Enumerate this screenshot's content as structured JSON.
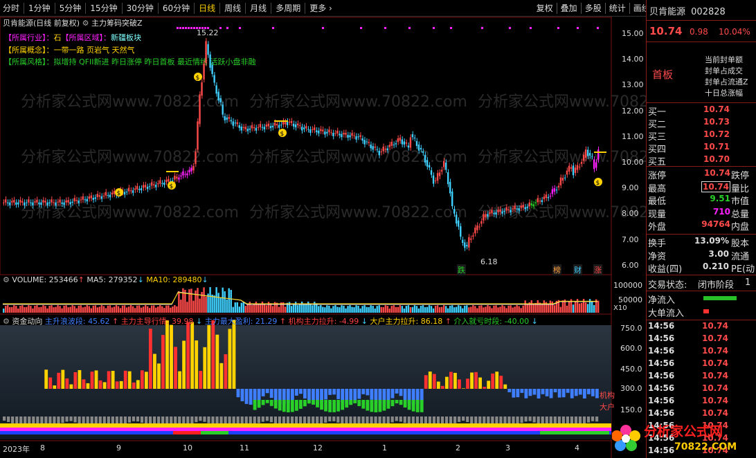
{
  "toolbar": {
    "periods": [
      "分时",
      "1分钟",
      "5分钟",
      "15分钟",
      "30分钟",
      "60分钟",
      "日线",
      "周线",
      "月线",
      "多周期",
      "更多"
    ],
    "active_period": "日线",
    "buttons": [
      "复权",
      "叠加",
      "多股",
      "统计",
      "画线",
      "F10",
      "标记",
      "+自选",
      "返回"
    ]
  },
  "chart": {
    "title": "贝肯能源(日线 前复权)",
    "indicator_name": "主力筹码突破Z",
    "info_line1": {
      "k1": "【所属行业】：",
      "v1": "石",
      "k2": "【所属区域】：",
      "v2": "新疆板块"
    },
    "info_line2": {
      "k": "【所属概念】：",
      "v": "一带一路 页岩气 天然气"
    },
    "info_line3": {
      "k": "【所属风格】：",
      "v": "拟增持 QFII新进 昨日涨停 昨日首板 最近情绪 活跃小盘非融"
    },
    "price_axis": [
      "15.00",
      "14.00",
      "13.00",
      "12.00",
      "11.00",
      "10.00",
      "9.00",
      "8.00",
      "7.00",
      "6.00"
    ],
    "high_label": "15.22",
    "low_label": "6.18",
    "signals": {
      "die": "跌",
      "bang": "榜",
      "cai": "财",
      "zhang": "涨"
    },
    "colors": {
      "up": "#ff4a4a",
      "down": "#3fd0ff",
      "magenta": "#ff20ff",
      "yellow": "#ffd200",
      "green": "#28d028"
    }
  },
  "volume": {
    "label": "VOLUME:",
    "value": "253466",
    "ma5_label": "MA5:",
    "ma5": "279352",
    "ma10_label": "MA10:",
    "ma10": "289480",
    "axis": [
      "100000",
      "50000"
    ],
    "unit": "X10"
  },
  "fund": {
    "name": "资金动向",
    "items": [
      {
        "label": "主升浪波段:",
        "value": "45.62",
        "color": "#3f7fff"
      },
      {
        "label": "主力主导行情:",
        "value": "39.98",
        "color": "#ff4040"
      },
      {
        "label": "主力最大盈利:",
        "value": "21.29",
        "color": "#3f7fff"
      },
      {
        "label": "机构主力拉升:",
        "value": "-4.99",
        "color": "#ff4040"
      },
      {
        "label": "大户主力拉升:",
        "value": "86.18",
        "color": "#ffd200"
      },
      {
        "label": "介入就亏时段:",
        "value": "-40.00",
        "color": "#28d028"
      }
    ],
    "axis": [
      "750.0",
      "600.0",
      "450.0",
      "300.0",
      "150.0"
    ],
    "right_tags": [
      "机构",
      "大户"
    ]
  },
  "dates": [
    "2023年",
    "8",
    "9",
    "10",
    "11",
    "12",
    "1",
    "2",
    "3",
    "4"
  ],
  "quote": {
    "name": "贝肯能源",
    "code": "002828",
    "price": "10.74",
    "change": "0.98",
    "pct": "10.04%",
    "board": "首板",
    "board_notes": [
      "当前封单额",
      "封单占成交",
      "封单占流通Z",
      "十日总涨幅"
    ],
    "bids": [
      {
        "label": "买一",
        "price": "10.74"
      },
      {
        "label": "买二",
        "price": "10.73"
      },
      {
        "label": "买三",
        "price": "10.72"
      },
      {
        "label": "买四",
        "price": "10.71"
      },
      {
        "label": "买五",
        "price": "10.70"
      }
    ],
    "stats": [
      {
        "k": "涨停",
        "v": "10.74",
        "k2": "跌停",
        "c": "#ff4a4a"
      },
      {
        "k": "最高",
        "v": "10.74",
        "k2": "量比",
        "c": "#ff4a4a"
      },
      {
        "k": "最低",
        "v": "9.51",
        "k2": "市值",
        "c": "#28d028"
      },
      {
        "k": "现量",
        "v": "710",
        "k2": "总量",
        "c": "#ff20ff"
      },
      {
        "k": "外盘",
        "v": "94764",
        "k2": "内盘",
        "c": "#ff4a4a"
      }
    ],
    "stats2": [
      {
        "k": "换手",
        "v": "13.09%",
        "k2": "股本"
      },
      {
        "k": "净资",
        "v": "3.00",
        "k2": "流通"
      },
      {
        "k": "收益(四)",
        "v": "0.210",
        "k2": "PE(动"
      }
    ],
    "trade_status_label": "交易状态:",
    "trade_status": "闭市阶段",
    "trade_status_num": "1",
    "net_inflow": "净流入",
    "big_inflow": "大单流入",
    "ticks": [
      {
        "t": "14:56",
        "p": "10.74"
      },
      {
        "t": "14:56",
        "p": "10.74"
      },
      {
        "t": "14:56",
        "p": "10.74"
      },
      {
        "t": "14:56",
        "p": "10.74"
      },
      {
        "t": "14:56",
        "p": "10.74"
      },
      {
        "t": "14:56",
        "p": "10.74"
      },
      {
        "t": "14:56",
        "p": "10.74"
      },
      {
        "t": "14:56",
        "p": "10.74"
      },
      {
        "t": "14:56",
        "p": "10.74"
      },
      {
        "t": "14:56",
        "p": "10.74"
      },
      {
        "t": "14:56",
        "p": "10.74"
      }
    ]
  },
  "watermark": "分析家公式网www.70822.com",
  "logo": {
    "text": "分析家公式网",
    "url": "70822.COM"
  }
}
